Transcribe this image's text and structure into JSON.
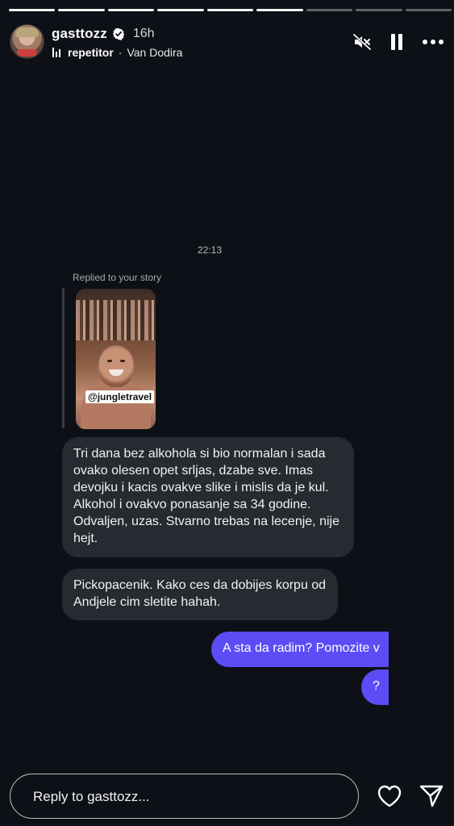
{
  "story": {
    "progress_total": 9,
    "progress_done": 6
  },
  "header": {
    "username": "gasttozz",
    "time_ago": "16h",
    "song": "repetitor",
    "separator": "·",
    "artist": "Van Dodira",
    "icons": [
      "muted-speaker-icon",
      "pause-icon",
      "more-icon"
    ]
  },
  "chat": {
    "timestamp": "22:13",
    "reply_label": "Replied to your story",
    "story_tag": "@jungletravel",
    "messages": [
      {
        "direction": "incoming",
        "text": "Tri dana bez alkohola si bio normalan i sada ovako olesen opet srljas, dzabe sve. Imas devojku i kacis ovakve slike i mislis da je kul. Alkohol i ovakvo ponasanje sa 34 godine. Odvaljen, uzas. Stvarno trebas na lecenje, nije hejt."
      },
      {
        "direction": "incoming",
        "text": "Pickopacenik. Kako ces da dobijes korpu od Andjele cim sletite hahah."
      },
      {
        "direction": "outgoing",
        "text": "A sta da radim? Pomozite v"
      },
      {
        "direction": "outgoing",
        "text": "?"
      }
    ]
  },
  "composer": {
    "placeholder": "Reply to gasttozz...",
    "icons": [
      "heart-icon",
      "send-icon"
    ]
  },
  "colors": {
    "background": "#0d1016",
    "incoming_bubble": "#262a31",
    "outgoing_bubble": "#5b4cf6"
  }
}
